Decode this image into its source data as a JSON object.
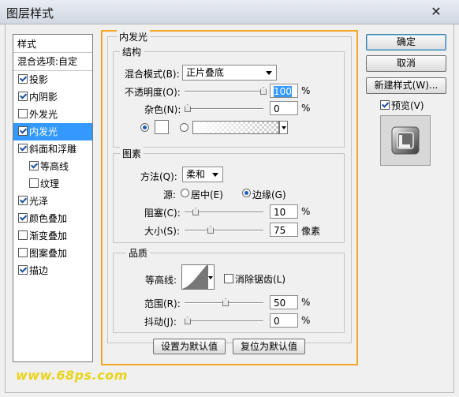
{
  "window": {
    "title": "图层样式"
  },
  "style_list": {
    "header": "样式",
    "blend_options": "混合选项:自定",
    "items": [
      {
        "label": "投影",
        "checked": true
      },
      {
        "label": "内阴影",
        "checked": true
      },
      {
        "label": "外发光",
        "checked": false
      },
      {
        "label": "内发光",
        "checked": true,
        "selected": true
      },
      {
        "label": "斜面和浮雕",
        "checked": true
      },
      {
        "label": "等高线",
        "checked": true,
        "sub": true
      },
      {
        "label": "纹理",
        "checked": false,
        "sub": true
      },
      {
        "label": "光泽",
        "checked": true
      },
      {
        "label": "颜色叠加",
        "checked": true
      },
      {
        "label": "渐变叠加",
        "checked": false
      },
      {
        "label": "图案叠加",
        "checked": false
      },
      {
        "label": "描边",
        "checked": true
      }
    ]
  },
  "panel": {
    "title": "内发光",
    "structure": {
      "title": "结构",
      "blend_mode_label": "混合模式(B):",
      "blend_mode_value": "正片叠底",
      "opacity_label": "不透明度(O):",
      "opacity_value": "100",
      "opacity_unit": "%",
      "opacity_level": 1.0,
      "noise_label": "杂色(N):",
      "noise_value": "0",
      "noise_unit": "%",
      "noise_level": 0.0
    },
    "elements": {
      "title": "图素",
      "method_label": "方法(Q):",
      "method_value": "柔和",
      "source_label": "源:",
      "source_center": "居中(E)",
      "source_edge": "边缘(G)",
      "choke_label": "阻塞(C):",
      "choke_value": "10",
      "choke_unit": "%",
      "choke_level": 0.1,
      "size_label": "大小(S):",
      "size_value": "75",
      "size_unit": "像素",
      "size_level": 0.3
    },
    "quality": {
      "title": "品质",
      "contour_label": "等高线:",
      "antialias_label": "消除锯齿(L)",
      "range_label": "范围(R):",
      "range_value": "50",
      "range_unit": "%",
      "range_level": 0.5,
      "jitter_label": "抖动(J):",
      "jitter_value": "0",
      "jitter_unit": "%",
      "jitter_level": 0.0
    },
    "set_default": "设置为默认值",
    "reset_default": "复位为默认值"
  },
  "buttons": {
    "ok": "确定",
    "cancel": "取消",
    "new_style": "新建样式(W)...",
    "preview": "预览(V)"
  },
  "watermark": "www.68ps.com",
  "colors": {
    "accent": "#3399ff",
    "highlight_border": "#f5a623"
  }
}
